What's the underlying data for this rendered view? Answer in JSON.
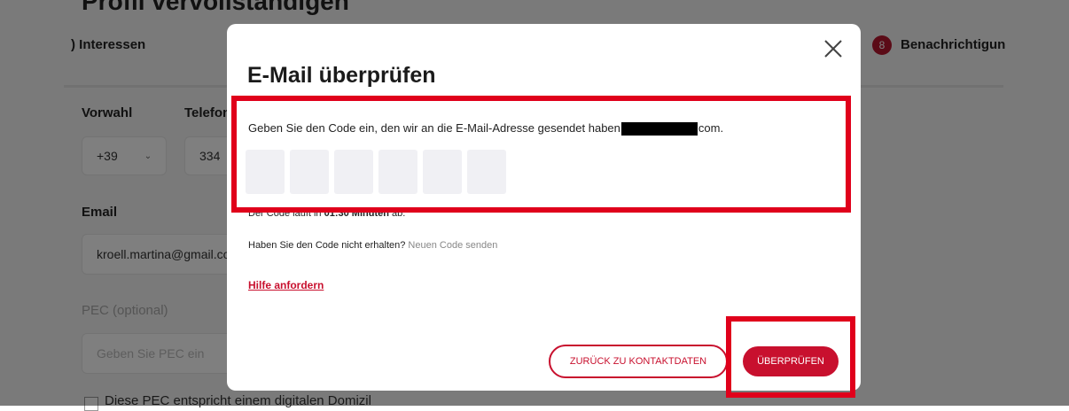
{
  "background": {
    "title": "Profil vervollständigen",
    "tab_left": ") Interessen",
    "tab_right_number": "8",
    "tab_right": "Benachrichtigun",
    "prefix_label": "Vorwahl",
    "phone_label": "Telefon",
    "prefix_value": "+39",
    "phone_value": "334",
    "email_label": "Email",
    "email_value": "kroell.martina@gmail.com",
    "pec_label": "PEC (optional)",
    "pec_placeholder": "Geben Sie PEC ein",
    "checkbox_label": "Diese PEC entspricht einem digitalen Domizil"
  },
  "modal": {
    "title": "E-Mail überprüfen",
    "close_icon": "close-icon",
    "description_prefix": "Geben Sie den Code ein, den wir an die E-Mail-Adresse gesendet haben",
    "description_suffix": "com.",
    "code_boxes": 6,
    "expiry_prefix": "Der Code läuft in",
    "expiry_time": "01:30 Minuten",
    "expiry_suffix": "ab.",
    "resend_question": "Haben Sie den Code nicht erhalten?",
    "resend_link": "Neuen Code senden",
    "help_link": "Hilfe anfordern",
    "back_button": "ZURÜCK ZU KONTAKTDATEN",
    "verify_button": "ÜBERPRÜFEN"
  },
  "colors": {
    "accent": "#c8102e",
    "highlight": "#e0001b",
    "overlay": "rgba(0,0,0,0.5)"
  }
}
